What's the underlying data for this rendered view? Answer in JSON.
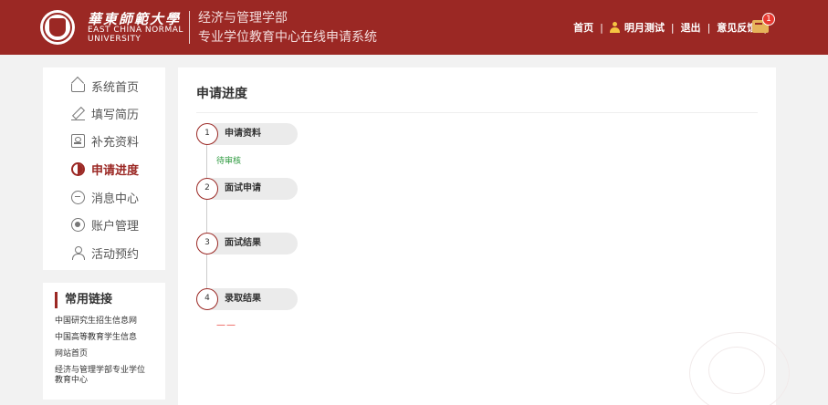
{
  "header": {
    "university_cn": "華東師範大學",
    "university_en_line1": "EAST CHINA NORMAL",
    "university_en_line2": "UNIVERSITY",
    "system_line1": "经济与管理学部",
    "system_line2": "专业学位教育中心在线申请系统",
    "nav": {
      "home": "首页",
      "user": "明月测试",
      "logout": "退出",
      "feedback": "意见反馈",
      "message_badge": "1"
    }
  },
  "sidebar": {
    "items": [
      {
        "label": "系统首页",
        "icon": "home-icon"
      },
      {
        "label": "填写简历",
        "icon": "edit-icon"
      },
      {
        "label": "补充资料",
        "icon": "document-icon"
      },
      {
        "label": "申请进度",
        "icon": "progress-icon",
        "active": true
      },
      {
        "label": "消息中心",
        "icon": "message-icon"
      },
      {
        "label": "账户管理",
        "icon": "account-icon"
      },
      {
        "label": "活动预约",
        "icon": "event-icon"
      }
    ],
    "links_title": "常用链接",
    "links": [
      "中国研究生招生信息网",
      "中国高等教育学生信息",
      "网站首页",
      "经济与管理学部专业学位",
      "教育中心"
    ]
  },
  "main": {
    "title": "申请进度",
    "steps": [
      {
        "number": "1",
        "label": "申请资料",
        "status": "待审核"
      },
      {
        "number": "2",
        "label": "面试申请"
      },
      {
        "number": "3",
        "label": "面试结果"
      },
      {
        "number": "4",
        "label": "录取结果",
        "status": "——"
      }
    ]
  },
  "colors": {
    "brand": "#9b2824",
    "pending_status": "#2d9a3f",
    "dash_status": "#e8382f",
    "badge": "#e8382f"
  }
}
